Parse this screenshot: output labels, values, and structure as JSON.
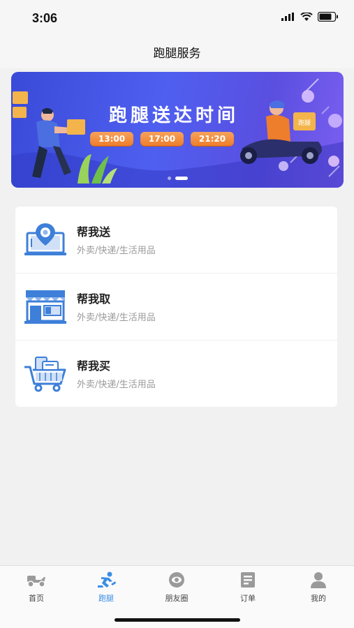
{
  "status": {
    "time": "3:06"
  },
  "nav": {
    "title": "跑腿服务"
  },
  "banner": {
    "title": "跑腿送达时间",
    "times": [
      "13:00",
      "17:00",
      "21:20"
    ],
    "box_label": "跑腿"
  },
  "services": [
    {
      "title": "帮我送",
      "subtitle": "外卖/快递/生活用品",
      "icon": "map-pin-laptop-icon"
    },
    {
      "title": "帮我取",
      "subtitle": "外卖/快递/生活用品",
      "icon": "storefront-icon"
    },
    {
      "title": "帮我买",
      "subtitle": "外卖/快递/生活用品",
      "icon": "shopping-cart-icon"
    }
  ],
  "tabs": [
    {
      "label": "首页",
      "icon": "scooter-icon",
      "active": false
    },
    {
      "label": "跑腿",
      "icon": "runner-icon",
      "active": true
    },
    {
      "label": "朋友圈",
      "icon": "eye-circle-icon",
      "active": false
    },
    {
      "label": "订单",
      "icon": "document-icon",
      "active": false
    },
    {
      "label": "我的",
      "icon": "user-icon",
      "active": false
    }
  ],
  "colors": {
    "accent": "#3a8ee6",
    "icon_blue": "#3d7fd9",
    "banner_bg": "#4f5ff0",
    "pill_orange": "#ee7d2c"
  }
}
